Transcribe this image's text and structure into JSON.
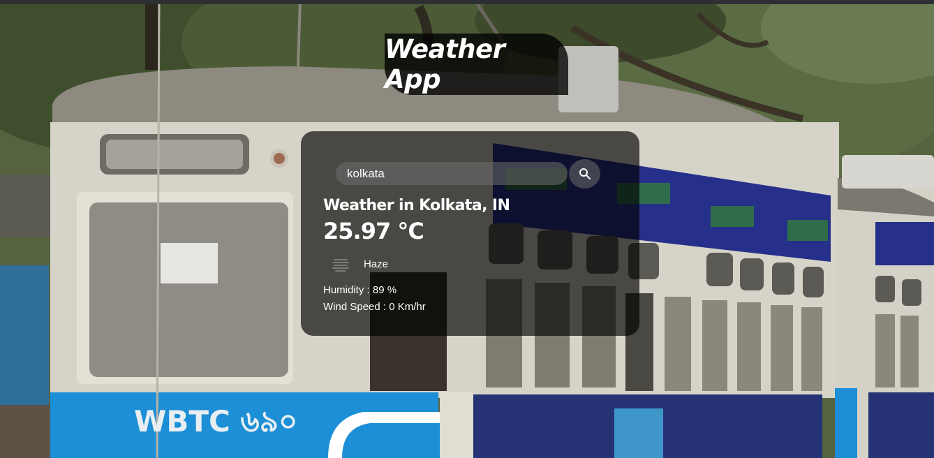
{
  "app": {
    "title": "Weather App"
  },
  "search": {
    "value": "kolkata",
    "placeholder": "",
    "button_icon": "search-icon"
  },
  "weather": {
    "heading": "Weather in Kolkata, IN",
    "temperature": "25.97 °C",
    "condition": "Haze",
    "condition_icon": "haze-icon",
    "humidity": "Humidity : 89 %",
    "wind": "Wind Speed : 0 Km/hr"
  },
  "colors": {
    "text": "#ffffff",
    "card_bg": "rgba(0,0,0,0.66)",
    "title_bg": "rgba(0,0,0,0.78)",
    "tram_blue": "#1c8fd6"
  }
}
